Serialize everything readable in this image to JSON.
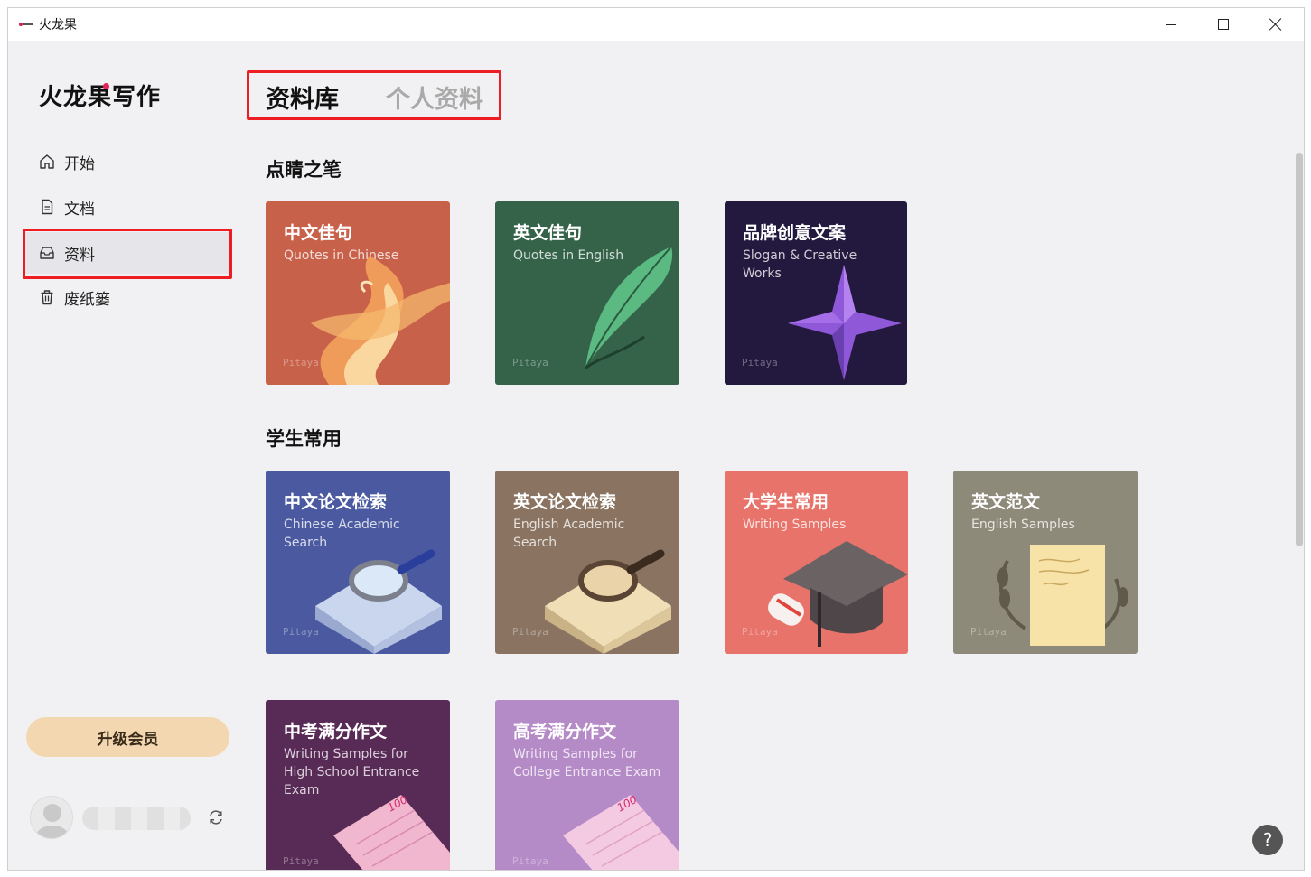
{
  "window": {
    "title": "火龙果"
  },
  "sidebar": {
    "logo": "火龙果写作",
    "items": [
      {
        "label": "开始",
        "icon": "home-icon",
        "active": false
      },
      {
        "label": "文档",
        "icon": "document-icon",
        "active": false
      },
      {
        "label": "资料",
        "icon": "inbox-icon",
        "active": true
      },
      {
        "label": "废纸篓",
        "icon": "trash-icon",
        "active": false
      }
    ],
    "upgrade_label": "升级会员"
  },
  "tabs": [
    {
      "label": "资料库",
      "active": true
    },
    {
      "label": "个人资料",
      "active": false
    }
  ],
  "sections": [
    {
      "title": "点睛之笔",
      "cards": [
        {
          "title": "中文佳句",
          "subtitle": "Quotes in Chinese",
          "brand": "Pitaya",
          "color": "#c8614a",
          "icon": "flame-icon"
        },
        {
          "title": "英文佳句",
          "subtitle": "Quotes in English",
          "brand": "Pitaya",
          "color": "#34634a",
          "icon": "feather-icon"
        },
        {
          "title": "品牌创意文案",
          "subtitle": "Slogan & Creative Works",
          "brand": "Pitaya",
          "color": "#23193f",
          "icon": "star-icon"
        }
      ]
    },
    {
      "title": "学生常用",
      "cards": [
        {
          "title": "中文论文检索",
          "subtitle": "Chinese Academic Search",
          "brand": "Pitaya",
          "color": "#4b5aa0",
          "icon": "magnifier-icon"
        },
        {
          "title": "英文论文检索",
          "subtitle": "English Academic Search",
          "brand": "Pitaya",
          "color": "#8a7461",
          "icon": "magnifier-icon"
        },
        {
          "title": "大学生常用",
          "subtitle": "Writing Samples",
          "brand": "Pitaya",
          "color": "#e8736a",
          "icon": "graduation-cap-icon"
        },
        {
          "title": "英文范文",
          "subtitle": "English Samples",
          "brand": "Pitaya",
          "color": "#8e8a7a",
          "icon": "paper-laurel-icon"
        },
        {
          "title": "中考满分作文",
          "subtitle": "Writing Samples for High School Entrance Exam",
          "brand": "Pitaya",
          "color": "#582a56",
          "icon": "score-paper-icon"
        },
        {
          "title": "高考满分作文",
          "subtitle": "Writing Samples for College Entrance Exam",
          "brand": "Pitaya",
          "color": "#b48ac7",
          "icon": "score-paper-icon"
        }
      ]
    }
  ],
  "colors": {
    "highlight_border": "#ee1d23",
    "upgrade_bg": "#f2d7b1",
    "logo_dot": "#e2265a"
  }
}
